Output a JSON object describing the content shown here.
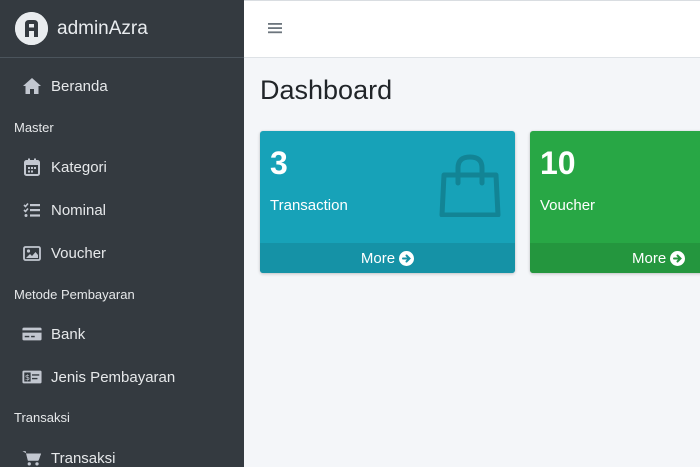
{
  "brand": {
    "name": "adminAzra",
    "logo_letter": "A"
  },
  "sidebar": {
    "items": [
      {
        "label": "Beranda",
        "icon": "home-icon"
      },
      {
        "label": "Kategori",
        "icon": "calendar-icon"
      },
      {
        "label": "Nominal",
        "icon": "list-check-icon"
      },
      {
        "label": "Voucher",
        "icon": "image-icon"
      },
      {
        "label": "Bank",
        "icon": "credit-card-icon"
      },
      {
        "label": "Jenis Pembayaran",
        "icon": "money-bill-icon"
      },
      {
        "label": "Transaksi",
        "icon": "cart-icon"
      }
    ],
    "headers": [
      "Master",
      "Metode Pembayaran",
      "Transaksi"
    ]
  },
  "header": {
    "menu_icon": "hamburger-icon"
  },
  "main": {
    "title": "Dashboard",
    "cards": [
      {
        "value": "3",
        "label": "Transaction",
        "more": "More",
        "color": "#17a2b8",
        "foot_color": "#1592a6",
        "icon": "shopping-bag-icon"
      },
      {
        "value": "10",
        "label": "Voucher",
        "more": "More",
        "color": "#28a745",
        "foot_color": "#24963e"
      }
    ]
  }
}
